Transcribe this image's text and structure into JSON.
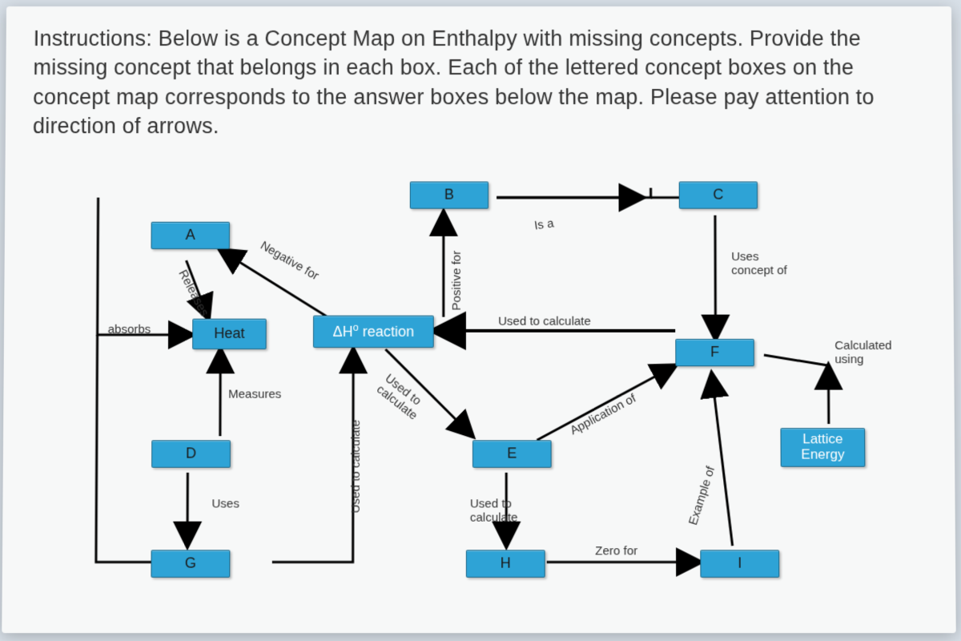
{
  "instructions": "Instructions: Below is a Concept Map on Enthalpy with missing concepts. Provide the missing concept that belongs in each box. Each of the lettered concept boxes on the concept map corresponds to the answer boxes below the map. Please pay attention to direction of arrows.",
  "nodes": {
    "A": "A",
    "B": "B",
    "C": "C",
    "D": "D",
    "E": "E",
    "F": "F",
    "G": "G",
    "H": "H",
    "I": "I",
    "Heat": "Heat",
    "dHreaction_prefix": "ΔH",
    "dHreaction_sup": "o",
    "dHreaction_suffix": " reaction",
    "LatticeEnergy": "Lattice Energy"
  },
  "edges": {
    "absorbs": "absorbs",
    "releases": "Releases",
    "negative_for": "Negative for",
    "positive_for": "Positive for",
    "is_a": "Is a",
    "uses_concept_of": "Uses concept of",
    "used_to_calculate": "Used to calculate",
    "calculated_using": "Calculated using",
    "measures": "Measures",
    "uses": "Uses",
    "used_to_calculate2": "Used to calculate",
    "used_to_calc_short1": "Used to",
    "used_to_calc_short2": "calculate",
    "application_of": "Application of",
    "example_of": "Example of",
    "used_to_calculate_v": "Used to calculate",
    "zero_for": "Zero for"
  }
}
